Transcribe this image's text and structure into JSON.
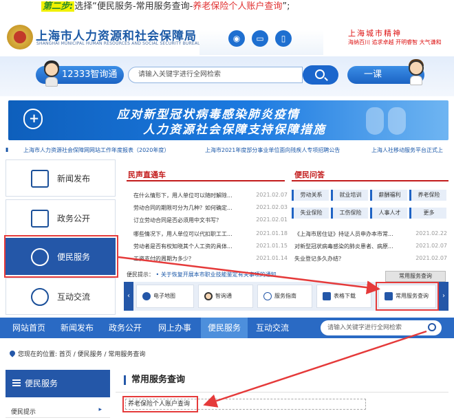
{
  "instruction": {
    "step": "第二步:",
    "prefix": "选择“便民服务-常用服务查询-",
    "highlight": "养老保险个人账户查询",
    "suffix": "”;"
  },
  "header": {
    "title_cn": "上海市人力资源和社会保障局",
    "title_en": "SHANGHAI MUNICIPAL HUMAN RESOURCES AND SOCIAL SECURITY BUREAU",
    "slogan_calligraphy": "上海城市精神",
    "slogan": "海纳百川  追求卓越  开明睿智  大气谦和",
    "social_icons": [
      "weibo-icon",
      "tv-icon",
      "mobile-icon"
    ]
  },
  "search": {
    "pill_label": "12333智询通",
    "placeholder": "请输入关键字进行全网检索",
    "yike_label": "一课"
  },
  "banner": {
    "line1": "应对新型冠状病毒感染肺炎疫情",
    "line2": "人力资源社会保障支持保障措施"
  },
  "ticker": [
    "上海市人力资源社会保障网网站工作年度报表（2020年度）",
    "上海市2021年度部分事业单位面向残疾人专项招聘公告",
    "上海人社移动服务平台正式上"
  ],
  "left_nav": [
    {
      "label": "新闻发布",
      "icon": "newspaper-icon"
    },
    {
      "label": "政务公开",
      "icon": "document-icon"
    },
    {
      "label": "便民服务",
      "icon": "people-icon"
    },
    {
      "label": "互动交流",
      "icon": "chat-icon"
    }
  ],
  "news": {
    "title": "民声直通车",
    "items": [
      {
        "text": "在什么情形下，用人单位可以随时解除...",
        "date": "2021.02.07"
      },
      {
        "text": "劳动合同的期限可分为几种？如何确定...",
        "date": "2021.02.03"
      },
      {
        "text": "订立劳动合同是否必须用中文书写？",
        "date": "2021.02.01"
      },
      {
        "text": "哪些情况下，用人单位可以代扣职工工...",
        "date": "2021.01.18"
      },
      {
        "text": "劳动者是否有权知晓其个人工资的具体...",
        "date": "2021.01.15"
      },
      {
        "text": "工资支付的周期为多少？",
        "date": "2021.01.14"
      }
    ]
  },
  "qa": {
    "title": "便民问答",
    "tags": [
      "劳动关系",
      "就业培训",
      "薪酬福利",
      "养老保险",
      "失业保险",
      "工伤保险",
      "人事人才",
      "更多"
    ],
    "items": [
      {
        "text": "《上海市居住证》持证人员申办本市常...",
        "date": "2021.02.22"
      },
      {
        "text": "对新型冠状病毒感染的肺炎患者、病原...",
        "date": "2021.02.07"
      },
      {
        "text": "失业登记多久办结？",
        "date": "2021.02.07"
      }
    ]
  },
  "tip": {
    "label": "便民提示：",
    "text": "关于恢复开展本市职业技能鉴定有关事项的通知"
  },
  "quick": {
    "tab": "常用服务查询",
    "items": [
      "电子地图",
      "智询通",
      "服务指南",
      "表格下载",
      "常用服务查询"
    ]
  },
  "navbar": {
    "items": [
      "网站首页",
      "新闻发布",
      "政务公开",
      "网上办事",
      "便民服务",
      "互动交流"
    ],
    "active": "便民服务",
    "search_placeholder": "请输入关键字进行全网检索"
  },
  "breadcrumb": {
    "label": "您现在的位置:",
    "path": "首页 / 便民服务 / 常用服务查询"
  },
  "sidebar": {
    "title": "便民服务",
    "sub": "便民提示"
  },
  "content": {
    "title": "常用服务查询",
    "item": "养老保险个人账户查询"
  },
  "colors": {
    "primary": "#2457a8",
    "highlight_red": "#e53a3a",
    "banner": "#1c7ae0"
  }
}
